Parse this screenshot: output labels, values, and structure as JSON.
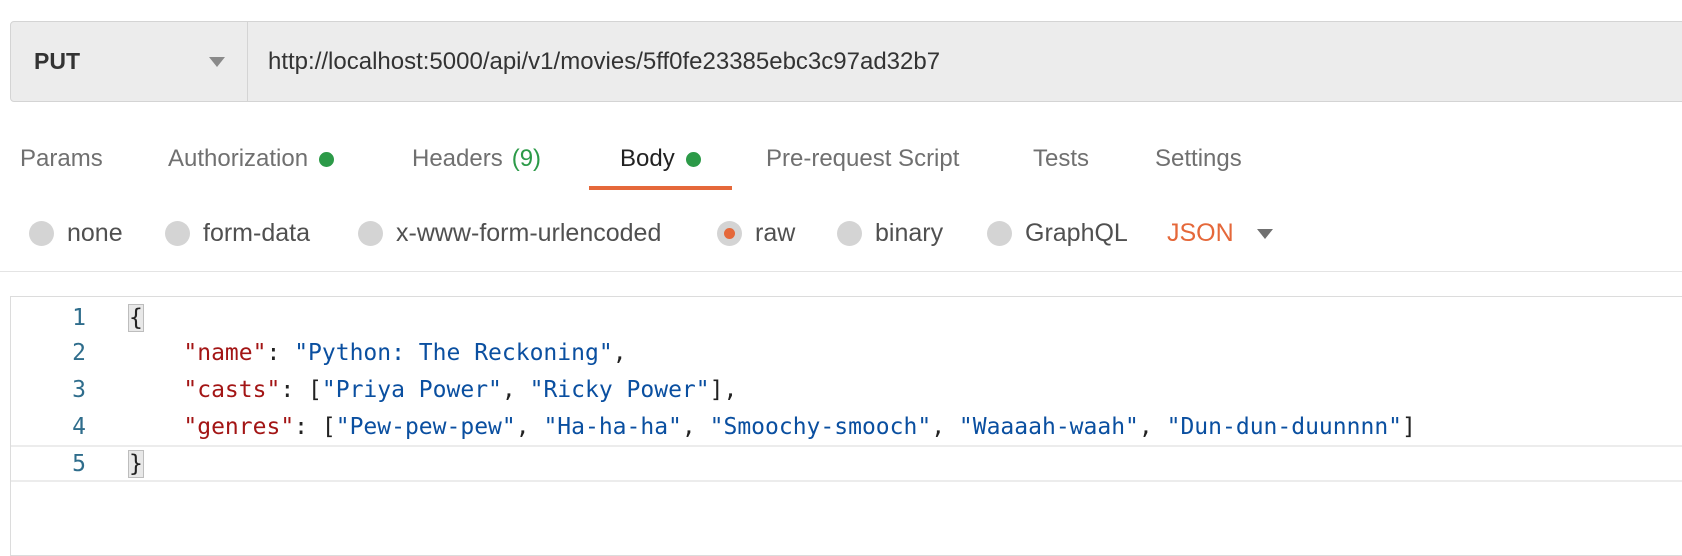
{
  "request": {
    "method": "PUT",
    "url": "http://localhost:5000/api/v1/movies/5ff0fe23385ebc3c97ad32b7"
  },
  "tabs": [
    {
      "label": "Params"
    },
    {
      "label": "Authorization"
    },
    {
      "label": "Headers",
      "count": "(9)"
    },
    {
      "label": "Body"
    },
    {
      "label": "Pre-request Script"
    },
    {
      "label": "Tests"
    },
    {
      "label": "Settings"
    }
  ],
  "body_options": [
    "none",
    "form-data",
    "x-www-form-urlencoded",
    "raw",
    "binary",
    "GraphQL"
  ],
  "body_format": "JSON",
  "editor": {
    "line_numbers": [
      "1",
      "2",
      "3",
      "4",
      "5"
    ],
    "line1": "{",
    "line2": {
      "key": "\"name\"",
      "value": "\"Python: The Reckoning\""
    },
    "line3": {
      "key": "\"casts\"",
      "values": [
        "\"Priya Power\"",
        "\"Ricky Power\""
      ]
    },
    "line4": {
      "key": "\"genres\"",
      "values": [
        "\"Pew-pew-pew\"",
        "\"Ha-ha-ha\"",
        "\"Smoochy-smooch\"",
        "\"Waaaah-waah\"",
        "\"Dun-dun-duunnnn\""
      ]
    },
    "line5": "}"
  },
  "colors": {
    "accent": "#e5683a",
    "status_green": "#2c9a48",
    "json_key": "#a31515",
    "json_string": "#0a4fa0"
  }
}
